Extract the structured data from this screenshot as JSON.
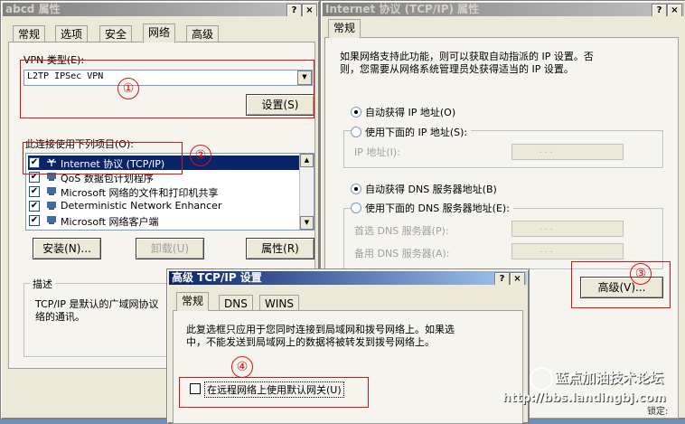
{
  "win1": {
    "title": "abcd 属性",
    "tabs": [
      "常规",
      "选项",
      "安全",
      "网络",
      "高级"
    ],
    "vpn_type_label": "VPN 类型(E):",
    "vpn_type_value": "L2TP IPSec VPN",
    "settings_button": "设置(S)",
    "items_label": "此连接使用下列项目(O):",
    "items": [
      {
        "label": "Internet 协议 (TCP/IP)",
        "checked": true,
        "selected": true
      },
      {
        "label": "QoS 数据包计划程序",
        "checked": true,
        "selected": false
      },
      {
        "label": "Microsoft 网络的文件和打印机共享",
        "checked": true,
        "selected": false
      },
      {
        "label": "Deterministic Network Enhancer",
        "checked": true,
        "selected": false
      },
      {
        "label": "Microsoft 网络客户端",
        "checked": true,
        "selected": false
      }
    ],
    "install_button": "安装(N)...",
    "uninstall_button": "卸载(U)",
    "properties_button": "属性(R)",
    "desc_group": "描述",
    "desc_text_1": "TCP/IP 是默认的广域网协议",
    "desc_text_2": "络的通讯。"
  },
  "win2": {
    "title": "Internet 协议 (TCP/IP) 属性",
    "tab": "常规",
    "intro_1": "如果网络支持此功能，则可以获取自动指派的 IP 设置。否",
    "intro_2": "则，您需要从网络系统管理员处获得适当的 IP 设置。",
    "auto_ip": "自动获得 IP 地址(O)",
    "use_ip": "使用下面的 IP 地址(S):",
    "ip_label": "IP 地址(I):",
    "auto_dns": "自动获得 DNS 服务器地址(B)",
    "use_dns": "使用下面的 DNS 服务器地址(E):",
    "pref_dns": "首选 DNS 服务器(P):",
    "alt_dns": "备用 DNS 服务器(A):",
    "advanced_button": "高级(V)..."
  },
  "win3": {
    "title": "高级 TCP/IP 设置",
    "tabs": [
      "常规",
      "DNS",
      "WINS"
    ],
    "info_1": "此复选框只应用于您同时连接到局域网和拨号网络上。如果选",
    "info_2": "中，不能发送到局域网上的数据将被转发到拨号网络上。",
    "gateway_checkbox": "在远程网络上使用默认网关(U)",
    "gateway_checked": false
  },
  "markers": [
    "①",
    "②",
    "③",
    "④"
  ],
  "watermark": {
    "name": "蓝点加油技术论坛",
    "url": "http://bbs.landingbj.com"
  },
  "bottom_right_label": "锁定:",
  "title_buttons": {
    "help": "?",
    "close": "×"
  },
  "dropdown_arrow": "▼",
  "check_mark": "✔",
  "ip_dots": ".   .   ."
}
